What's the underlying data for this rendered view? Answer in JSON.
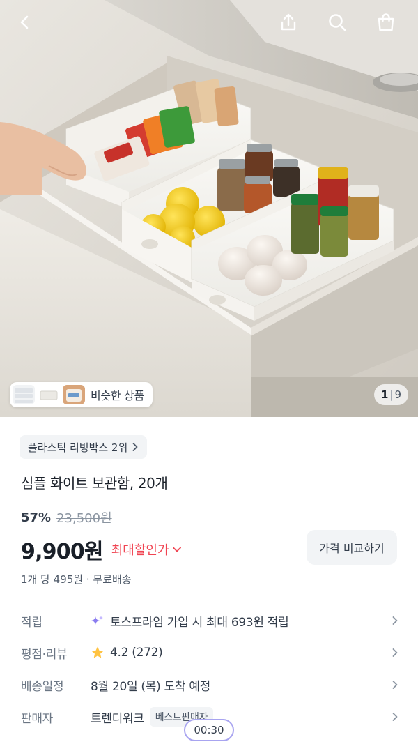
{
  "gallery": {
    "similar_label": "비슷한 상품",
    "current": "1",
    "separator": "|",
    "total": "9"
  },
  "product": {
    "rank_badge": "플라스틱 리빙박스 2위",
    "title": "심플 화이트 보관함, 20개",
    "discount_rate": "57%",
    "original_price": "23,500원",
    "price": "9,900원",
    "max_discount_label": "최대할인가",
    "compare_button": "가격 비교하기",
    "unit_price": "1개 당 495원 · 무료배송"
  },
  "details": {
    "points": {
      "key": "적립",
      "value": "토스프라임 가입 시 최대 693원 적립"
    },
    "rating": {
      "key": "평점·리뷰",
      "value": "4.2 (272)"
    },
    "delivery": {
      "key": "배송일정",
      "value": "8월 20일 (목) 도착 예정"
    },
    "seller": {
      "key": "판매자",
      "value": "트렌디워크",
      "badge": "베스트판매자"
    }
  },
  "overlay": {
    "timer": "00:30"
  },
  "colors": {
    "accent_red": "#f04452",
    "star": "#ffc342",
    "text_primary": "#191f28",
    "chip_bg": "#f2f4f6"
  },
  "icons": [
    "back-arrow-icon",
    "share-icon",
    "search-icon",
    "shopping-bag-icon",
    "chevron-right-icon",
    "chevron-down-icon",
    "star-icon",
    "sparkle-icon"
  ]
}
